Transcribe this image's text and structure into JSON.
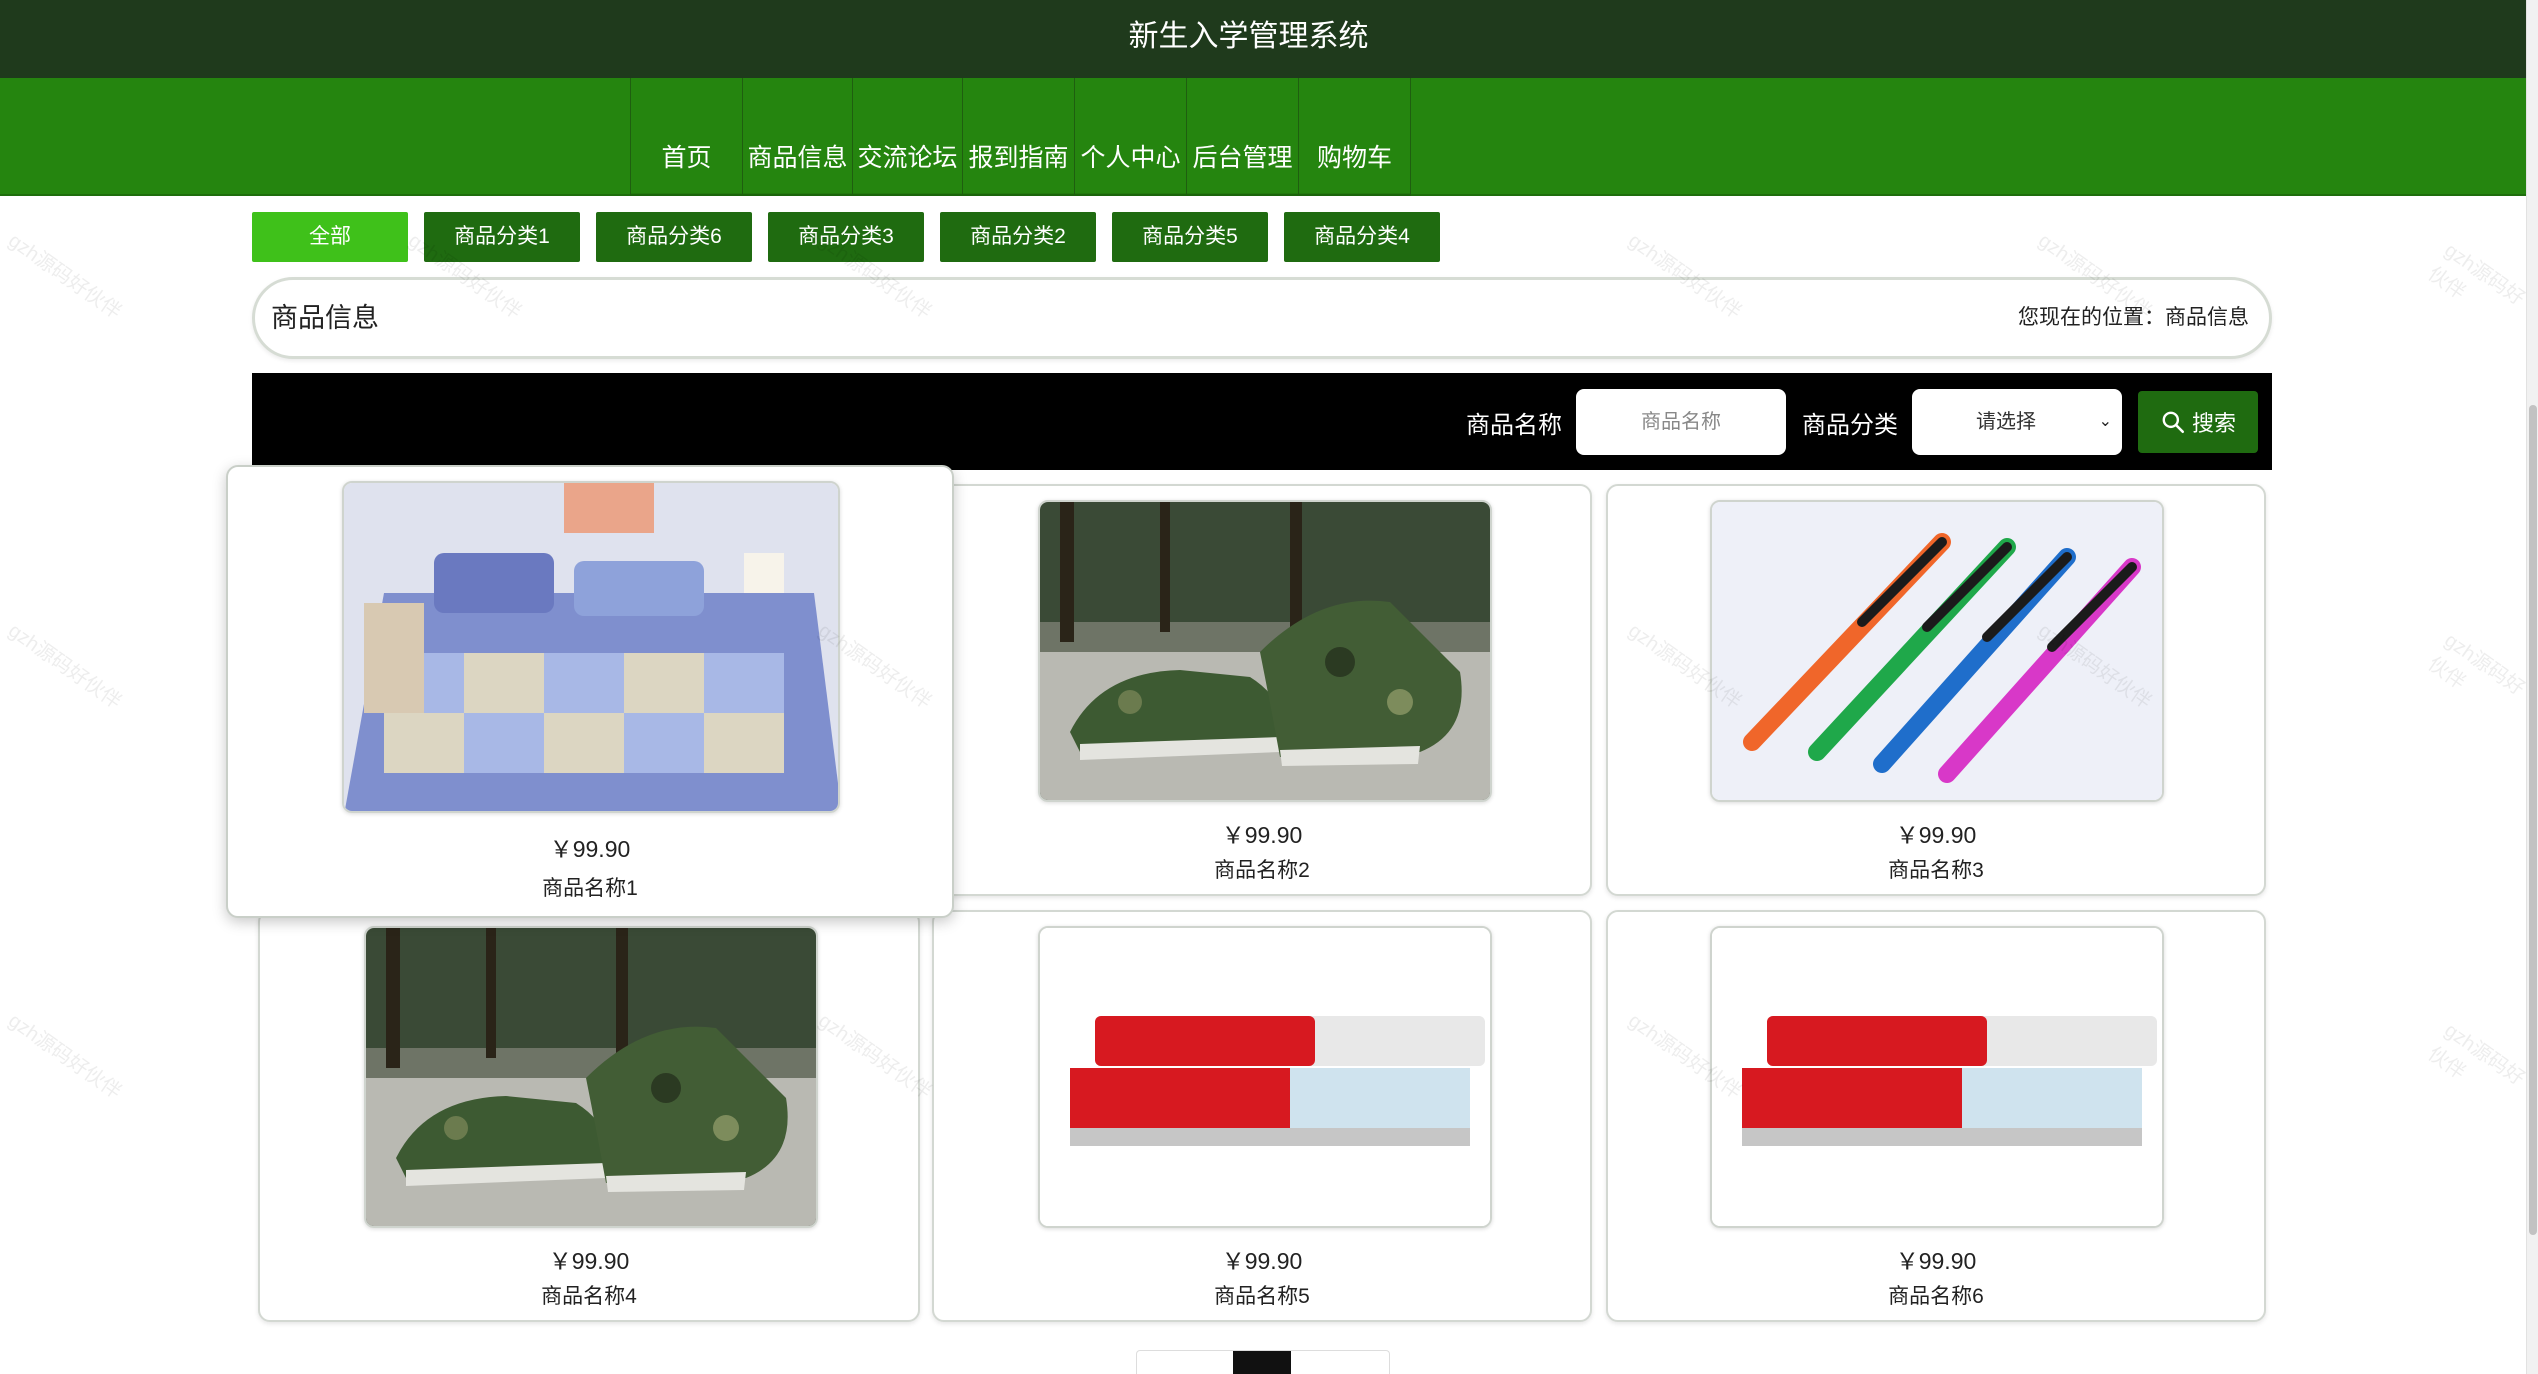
{
  "site": {
    "title": "新生入学管理系统"
  },
  "nav": {
    "items": [
      {
        "label": "首页"
      },
      {
        "label": "商品信息"
      },
      {
        "label": "交流论坛"
      },
      {
        "label": "报到指南"
      },
      {
        "label": "个人中心"
      },
      {
        "label": "后台管理"
      },
      {
        "label": "购物车"
      }
    ]
  },
  "categories": [
    {
      "label": "全部",
      "active": true
    },
    {
      "label": "商品分类1"
    },
    {
      "label": "商品分类6"
    },
    {
      "label": "商品分类3"
    },
    {
      "label": "商品分类2"
    },
    {
      "label": "商品分类5"
    },
    {
      "label": "商品分类4"
    }
  ],
  "header": {
    "title": "商品信息",
    "breadcrumb": "您现在的位置：商品信息"
  },
  "search": {
    "name_label": "商品名称",
    "name_placeholder": "商品名称",
    "category_label": "商品分类",
    "category_value": "请选择",
    "button_label": "搜索"
  },
  "products": [
    {
      "price": "￥99.90",
      "name": "商品名称1",
      "image": "bedding-set"
    },
    {
      "price": "￥99.90",
      "name": "商品名称2",
      "image": "camo-shoes"
    },
    {
      "price": "￥99.90",
      "name": "商品名称3",
      "image": "toothbrushes"
    },
    {
      "price": "￥99.90",
      "name": "商品名称4",
      "image": "camo-shoes"
    },
    {
      "price": "￥99.90",
      "name": "商品名称5",
      "image": "toothpaste"
    },
    {
      "price": "￥99.90",
      "name": "商品名称6",
      "image": "toothpaste"
    }
  ],
  "watermark": "gzh源码好伙伴",
  "colors": {
    "topbar": "#1f3a1c",
    "navbar": "#25850f",
    "category_button": "#1f6b10",
    "category_active": "#3fc11a",
    "search_bar": "#000000"
  }
}
